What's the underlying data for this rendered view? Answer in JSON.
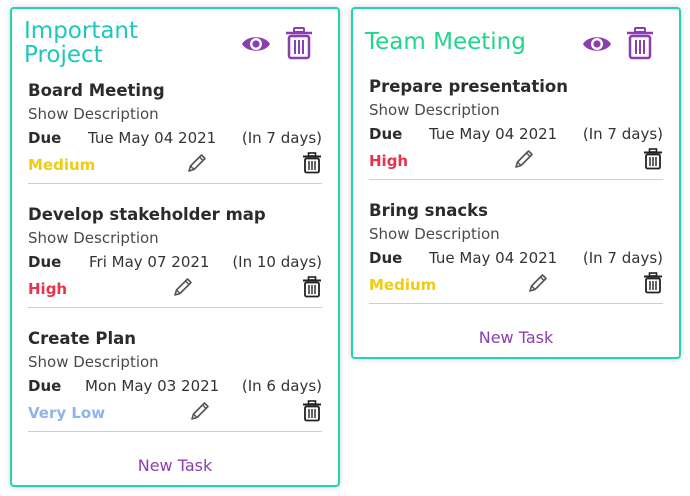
{
  "colors": {
    "card_border": "#1fd6b0",
    "accent_purple": "#8a3fb0",
    "priority_medium": "#f2cc0f",
    "priority_high": "#e8334a",
    "priority_very_low": "#8fb3ee"
  },
  "projects": [
    {
      "title": "Important Project",
      "title_color": "#1fc6c0",
      "view_icon": "eye-icon",
      "delete_icon": "trash-icon",
      "new_task_label": "New Task",
      "tasks": [
        {
          "name": "Board Meeting",
          "show_description": "Show Description",
          "due_label": "Due",
          "due_date": "Tue May 04 2021",
          "due_in": "(In 7 days)",
          "priority": "Medium",
          "priority_color": "#f2cc0f"
        },
        {
          "name": "Develop stakeholder map",
          "show_description": "Show Description",
          "due_label": "Due",
          "due_date": "Fri May 07 2021",
          "due_in": "(In 10 days)",
          "priority": "High",
          "priority_color": "#e8334a"
        },
        {
          "name": "Create Plan",
          "show_description": "Show Description",
          "due_label": "Due",
          "due_date": "Mon May 03 2021",
          "due_in": "(In 6 days)",
          "priority": "Very Low",
          "priority_color": "#8fb3ee"
        }
      ]
    },
    {
      "title": "Team Meeting",
      "title_color": "#1fd68a",
      "view_icon": "eye-icon",
      "delete_icon": "trash-icon",
      "new_task_label": "New Task",
      "tasks": [
        {
          "name": "Prepare presentation",
          "show_description": "Show Description",
          "due_label": "Due",
          "due_date": "Tue May 04 2021",
          "due_in": "(In 7 days)",
          "priority": "High",
          "priority_color": "#e8334a"
        },
        {
          "name": "Bring snacks",
          "show_description": "Show Description",
          "due_label": "Due",
          "due_date": "Tue May 04 2021",
          "due_in": "(In 7 days)",
          "priority": "Medium",
          "priority_color": "#f2cc0f"
        }
      ]
    }
  ]
}
